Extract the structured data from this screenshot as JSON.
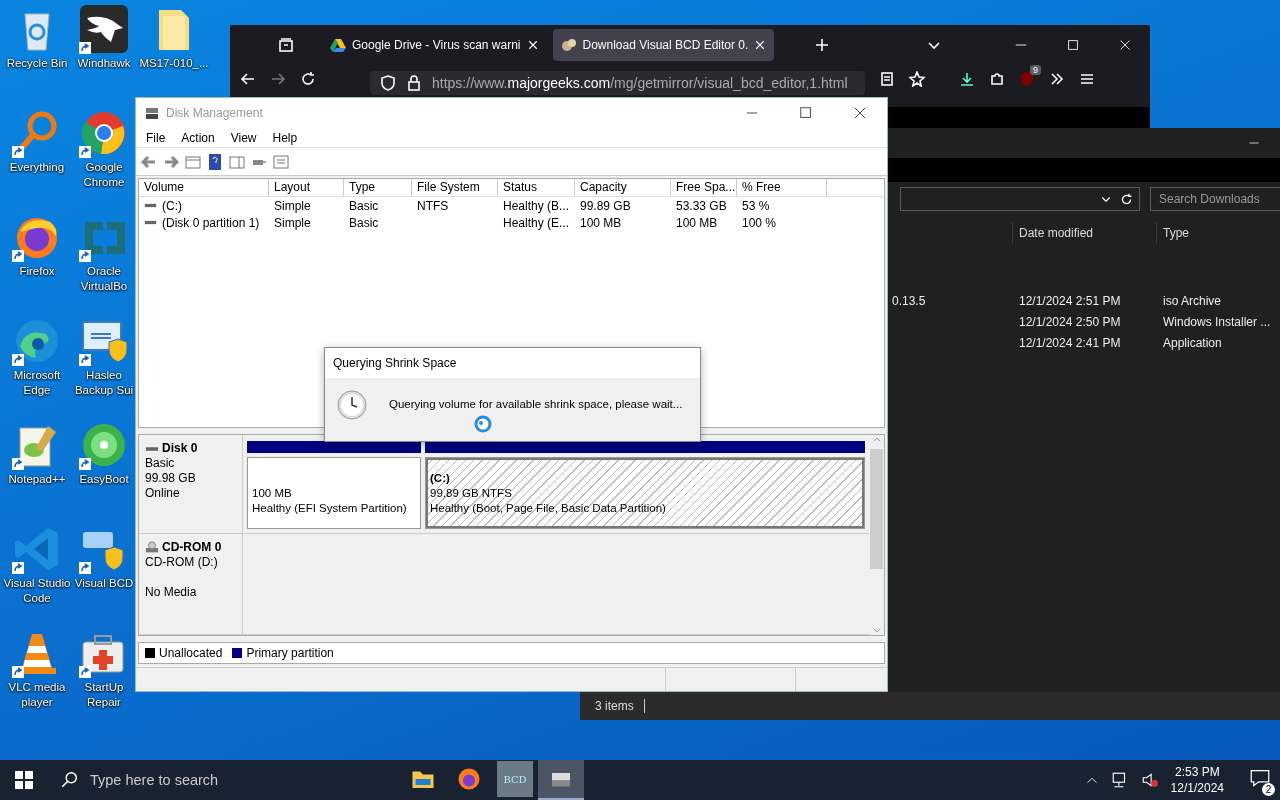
{
  "desktop_icons": [
    {
      "label": "Recycle Bin",
      "kind": "recycle",
      "shortcut": false
    },
    {
      "label": "Everything",
      "kind": "magnifier",
      "shortcut": true
    },
    {
      "label": "Firefox",
      "kind": "firefox",
      "shortcut": true
    },
    {
      "label": "Microsoft Edge",
      "kind": "edge",
      "shortcut": true
    },
    {
      "label": "Notepad++",
      "kind": "notepad",
      "shortcut": true
    },
    {
      "label": "Visual Studio Code",
      "kind": "vscode",
      "shortcut": true
    },
    {
      "label": "VLC media player",
      "kind": "cone",
      "shortcut": true
    },
    {
      "label": "Windhawk",
      "kind": "eagle",
      "shortcut": true
    },
    {
      "label": "Google Chrome",
      "kind": "chrome",
      "shortcut": true
    },
    {
      "label": "Oracle VirtualBo",
      "kind": "vbox",
      "shortcut": true
    },
    {
      "label": "Hasleo Backup Sui",
      "kind": "monitor",
      "shortcut": true
    },
    {
      "label": "EasyBoot",
      "kind": "disc",
      "shortcut": true
    },
    {
      "label": "Visual BCD",
      "kind": "bcd",
      "shortcut": true
    },
    {
      "label": "StartUp Repair",
      "kind": "kit",
      "shortcut": true
    },
    {
      "label": "MS17-010_...",
      "kind": "folder",
      "shortcut": false
    }
  ],
  "browser": {
    "tabs": [
      {
        "title": "Google Drive - Virus scan warni",
        "selected": false
      },
      {
        "title": "Download Visual BCD Editor 0.",
        "selected": true
      }
    ],
    "url_prefix": "https://www.",
    "url_domain": "majorgeeks.com",
    "url_path": "/mg/getmirror/visual_bcd_editor,1.html",
    "extension_badge": "9"
  },
  "explorer": {
    "search_placeholder": "Search Downloads",
    "columns": [
      "Date modified",
      "Type"
    ],
    "rows": [
      {
        "name": "0.13.5",
        "date": "12/1/2024 2:51 PM",
        "type": "iso Archive"
      },
      {
        "date": "12/1/2024 2:50 PM",
        "type": "Windows Installer ..."
      },
      {
        "date": "12/1/2024 2:41 PM",
        "type": "Application"
      }
    ],
    "status": "3 items"
  },
  "disk_management": {
    "title": "Disk Management",
    "menu": [
      "File",
      "Action",
      "View",
      "Help"
    ],
    "columns": [
      "Volume",
      "Layout",
      "Type",
      "File System",
      "Status",
      "Capacity",
      "Free Spa...",
      "% Free"
    ],
    "volumes": [
      {
        "volume": "(C:)",
        "layout": "Simple",
        "type": "Basic",
        "file_system": "NTFS",
        "status": "Healthy (B...",
        "capacity": "99.89 GB",
        "free_space": "53.33 GB",
        "percent_free": "53 %"
      },
      {
        "volume": "(Disk 0 partition 1)",
        "layout": "Simple",
        "type": "Basic",
        "status": "Healthy (E...",
        "capacity": "100 MB",
        "free_space": "100 MB",
        "percent_free": "100 %"
      }
    ],
    "disks": [
      {
        "name": "Disk 0",
        "kind": "disk",
        "details": [
          "Basic",
          "99.98 GB",
          "Online"
        ],
        "partitions": [
          {
            "size": "100 MB",
            "status": "Healthy (EFI System Partition)",
            "selected": false
          },
          {
            "name": "(C:)",
            "size": "99.89 GB NTFS",
            "status": "Healthy (Boot, Page File, Basic Data Partition)",
            "selected": true
          }
        ]
      },
      {
        "name": "CD-ROM 0",
        "kind": "cdrom",
        "details": [
          "CD-ROM (D:)"
        ],
        "media": "No Media"
      }
    ],
    "legend": [
      {
        "label": "Unallocated",
        "color": "#000000"
      },
      {
        "label": "Primary partition",
        "color": "#000080"
      }
    ]
  },
  "dialog": {
    "title": "Querying Shrink Space",
    "message": "Querying volume for available shrink space, please wait..."
  },
  "taskbar": {
    "search_placeholder": "Type here to search",
    "apps": [
      {
        "kind": "folder",
        "active": false
      },
      {
        "kind": "firefox",
        "active": false
      },
      {
        "kind": "bcd",
        "label": "BCD",
        "active": false
      },
      {
        "kind": "diskmgmt",
        "active": true
      }
    ],
    "time": "2:53 PM",
    "date": "12/1/2024",
    "notification_count": "2"
  }
}
